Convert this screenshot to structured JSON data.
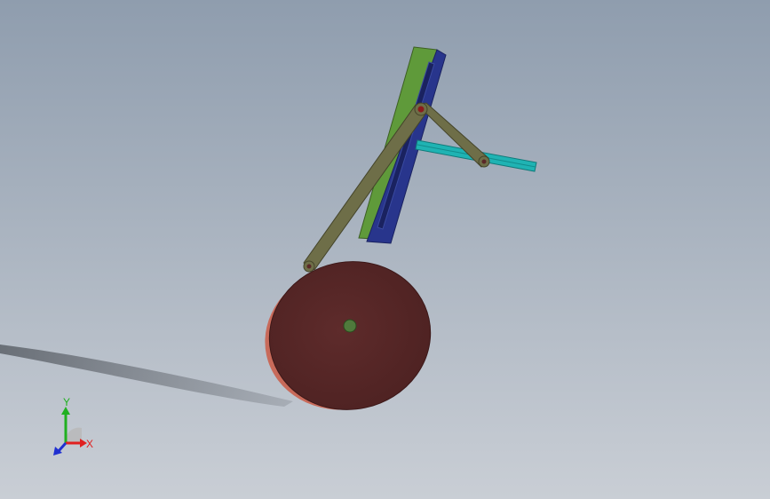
{
  "viewport": {
    "background_top": "#8f9dae",
    "background_bottom": "#c9ced5"
  },
  "model": {
    "parts": [
      {
        "name": "crank-disc",
        "color": "#5a2828"
      },
      {
        "name": "slotted-guide",
        "color": "#28358c"
      },
      {
        "name": "guide-side-face",
        "color": "#5f9a3a"
      },
      {
        "name": "connecting-rod",
        "color": "#6e6e48"
      },
      {
        "name": "rocker-link",
        "color": "#6e6e48"
      },
      {
        "name": "slider-bar",
        "color": "#1fb3b3"
      },
      {
        "name": "pivot-pin",
        "color": "#4f7a3c"
      }
    ]
  },
  "triad": {
    "x_label": "X",
    "y_label": "Y",
    "x_color": "#e02020",
    "y_color": "#20b020",
    "z_color": "#2030d0"
  }
}
